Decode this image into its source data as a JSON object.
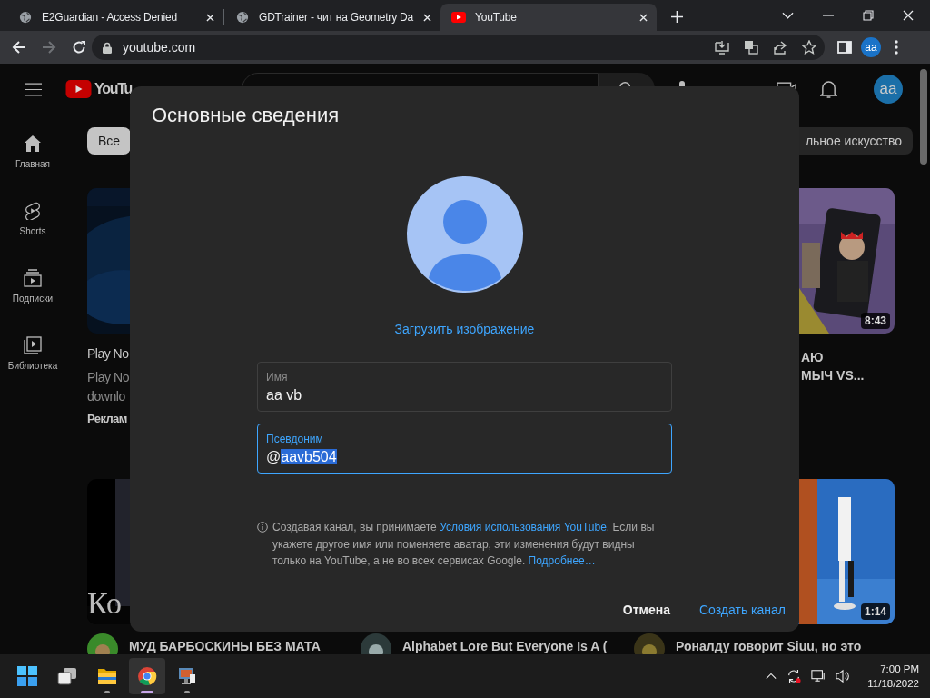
{
  "browser": {
    "tabs": [
      {
        "title": "E2Guardian - Access Denied",
        "selected": false
      },
      {
        "title": "GDTrainer - чит на Geometry Da",
        "selected": false
      },
      {
        "title": "YouTube",
        "selected": true
      }
    ],
    "forward_button": {
      "disabled": true
    },
    "address": "youtube.com",
    "profile": "aa"
  },
  "youtube": {
    "logo": "YouTu",
    "avatar": "aa",
    "sidebar": [
      {
        "label": "Главная"
      },
      {
        "label": "Shorts"
      },
      {
        "label": "Подписки"
      },
      {
        "label": "Библиотека"
      }
    ],
    "chips": [
      {
        "label": "Все",
        "selected": true
      },
      {
        "label": "льное искусство",
        "selected": false
      }
    ],
    "rows": [
      {
        "cells": [
          {
            "kind": "ad",
            "title": "Play No",
            "description": [
              "Play No",
              "downlo"
            ],
            "tag": "Реклам"
          },
          {
            "kind": "covered"
          },
          {
            "kind": "video",
            "duration": "8:43",
            "title_lines": [
              "АЮ",
              "МЫЧ VS..."
            ]
          }
        ]
      },
      {
        "cells": [
          {
            "kind": "video",
            "overlay_text": "Ко",
            "title_lines": [
              "МУД БАРБОСКИНЫ БЕЗ МАТА"
            ]
          },
          {
            "kind": "video",
            "title_lines": [
              "Alphabet Lore But Everyone Is A ("
            ]
          },
          {
            "kind": "video",
            "duration": "1:14",
            "title_lines": [
              "Роналду говорит Siuu, но это"
            ]
          }
        ]
      }
    ]
  },
  "dialog": {
    "title": "Основные сведения",
    "upload_link": "Загрузить изображение",
    "fields": [
      {
        "label": "Имя",
        "value": "aa vb",
        "focused": false,
        "value_selected": false
      },
      {
        "label": "Псевдоним",
        "prefix": "@",
        "value": "aavb504",
        "focused": true,
        "value_selected": true
      }
    ],
    "notice": [
      {
        "kind": "text",
        "text": "Создавая канал, вы принимаете "
      },
      {
        "kind": "link",
        "text": "Условия использования YouTube"
      },
      {
        "kind": "text",
        "text": ". Если вы укажете другое имя или поменяете аватар, эти изменения будут видны только на YouTube, а не во всех сервисах Google. "
      },
      {
        "kind": "link",
        "text": "Подробнее…"
      }
    ],
    "buttons": [
      {
        "label": "Отмена",
        "kind": "secondary"
      },
      {
        "label": "Создать канал",
        "kind": "primary"
      }
    ]
  },
  "taskbar": {
    "apps": [
      {
        "running": false,
        "selected": false
      },
      {
        "running": false,
        "selected": false
      },
      {
        "running": true,
        "selected": false
      },
      {
        "running": true,
        "selected": true
      },
      {
        "running": true,
        "selected": false
      }
    ],
    "time": "7:00 PM",
    "date": "11/18/2022"
  }
}
